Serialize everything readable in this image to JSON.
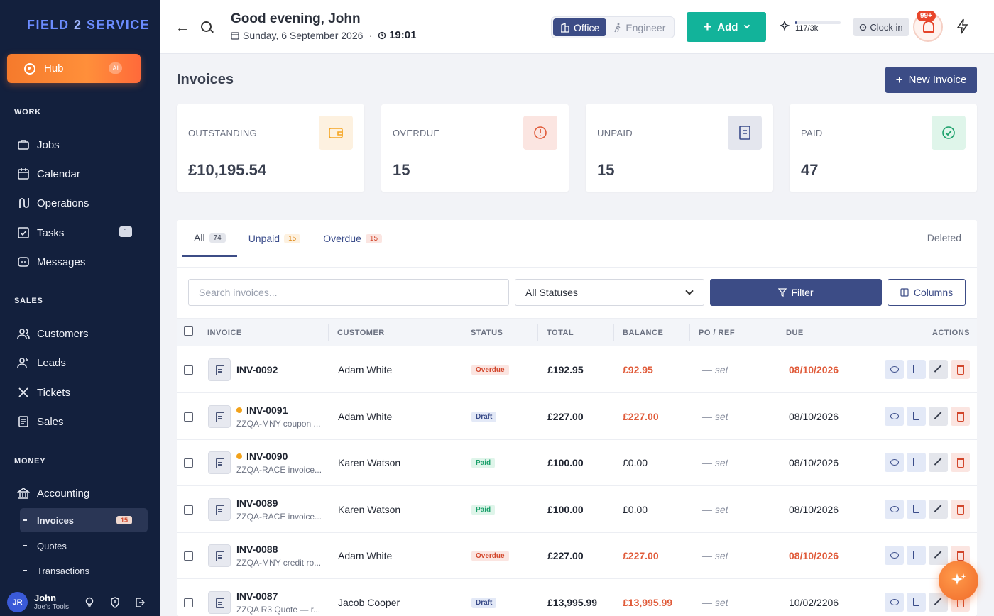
{
  "brand": {
    "logo_part1": "FIELD",
    "logo_part2": "2",
    "logo_part3": "SERVICE"
  },
  "sidebar": {
    "hub_label": "Hub",
    "hub_badge": "AI",
    "sections": {
      "work": "WORK",
      "sales": "SALES",
      "money": "MONEY"
    },
    "work_items": [
      {
        "label": "Jobs",
        "icon": "briefcase-icon"
      },
      {
        "label": "Calendar",
        "icon": "calendar-icon"
      },
      {
        "label": "Operations",
        "icon": "route-icon"
      },
      {
        "label": "Tasks",
        "icon": "checkbox-icon",
        "badge": "1"
      },
      {
        "label": "Messages",
        "icon": "chat-icon"
      }
    ],
    "sales_items": [
      {
        "label": "Customers",
        "icon": "users-icon"
      },
      {
        "label": "Leads",
        "icon": "lead-icon"
      },
      {
        "label": "Tickets",
        "icon": "tools-icon"
      },
      {
        "label": "Sales",
        "icon": "receipt-icon"
      }
    ],
    "money_items": [
      {
        "label": "Accounting",
        "icon": "bank-icon"
      }
    ],
    "money_sub": [
      {
        "label": "Invoices",
        "badge": "15",
        "active": true
      },
      {
        "label": "Quotes"
      },
      {
        "label": "Transactions"
      }
    ],
    "user": {
      "initials": "JR",
      "name": "John",
      "company": "Joe's Tools"
    }
  },
  "topbar": {
    "greeting": "Good evening, John",
    "date": "Sunday, 6 September 2026",
    "time": "19:01",
    "mode_office": "Office",
    "mode_engineer": "Engineer",
    "add_label": "Add",
    "usage_text": "117/3k",
    "usage_fraction": 0.039,
    "clock_in": "Clock in",
    "notif_count": "99+"
  },
  "page": {
    "title": "Invoices",
    "new_invoice": "New Invoice",
    "stats": [
      {
        "label": "OUTSTANDING",
        "value": "£10,195.54",
        "icon": "wallet-icon",
        "color": "#f5a623",
        "bg": "#fdf1e0"
      },
      {
        "label": "OVERDUE",
        "value": "15",
        "icon": "alert-circle-icon",
        "color": "#e05b3a",
        "bg": "#fbe5e1"
      },
      {
        "label": "UNPAID",
        "value": "15",
        "icon": "document-icon",
        "color": "#3a4c8a",
        "bg": "#e4e6ee"
      },
      {
        "label": "PAID",
        "value": "47",
        "icon": "check-circle-icon",
        "color": "#1aa06a",
        "bg": "#dff5ea"
      }
    ],
    "tabs": [
      {
        "label": "All",
        "count": "74"
      },
      {
        "label": "Unpaid",
        "count": "15"
      },
      {
        "label": "Overdue",
        "count": "15"
      }
    ],
    "deleted_tab": "Deleted",
    "search_placeholder": "Search invoices...",
    "status_filter": "All Statuses",
    "filter_label": "Filter",
    "columns_label": "Columns",
    "columns": {
      "invoice": "INVOICE",
      "customer": "CUSTOMER",
      "status": "STATUS",
      "total": "TOTAL",
      "balance": "BALANCE",
      "po": "PO / REF",
      "due": "DUE",
      "actions": "ACTIONS"
    },
    "rows": [
      {
        "number": "INV-0092",
        "dot": false,
        "sub": "",
        "customer": "Adam White",
        "status": "Overdue",
        "total": "£192.95",
        "balance": "£92.95",
        "po": "— set",
        "due": "08/10/2026",
        "due_overdue": true
      },
      {
        "number": "INV-0091",
        "dot": true,
        "sub": "ZZQA-MNY coupon ...",
        "customer": "Adam White",
        "status": "Draft",
        "total": "£227.00",
        "balance": "£227.00",
        "po": "— set",
        "due": "08/10/2026",
        "due_overdue": false
      },
      {
        "number": "INV-0090",
        "dot": true,
        "sub": "ZZQA-RACE invoice...",
        "customer": "Karen Watson",
        "status": "Paid",
        "total": "£100.00",
        "balance": "£0.00",
        "po": "— set",
        "due": "08/10/2026",
        "due_overdue": false
      },
      {
        "number": "INV-0089",
        "dot": false,
        "sub": "ZZQA-RACE invoice...",
        "customer": "Karen Watson",
        "status": "Paid",
        "total": "£100.00",
        "balance": "£0.00",
        "po": "— set",
        "due": "08/10/2026",
        "due_overdue": false
      },
      {
        "number": "INV-0088",
        "dot": false,
        "sub": "ZZQA-MNY credit ro...",
        "customer": "Adam White",
        "status": "Overdue",
        "total": "£227.00",
        "balance": "£227.00",
        "po": "— set",
        "due": "08/10/2026",
        "due_overdue": true
      },
      {
        "number": "INV-0087",
        "dot": false,
        "sub": "ZZQA R3 Quote — r...",
        "customer": "Jacob Cooper",
        "status": "Draft",
        "total": "£13,995.99",
        "balance": "£13,995.99",
        "po": "— set",
        "due": "10/02/2206",
        "due_overdue": false
      }
    ]
  }
}
